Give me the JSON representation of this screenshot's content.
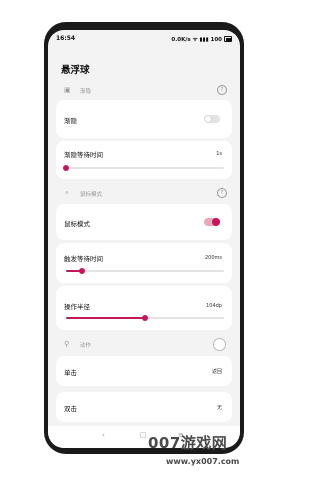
{
  "status": {
    "time": "16:54",
    "right": "0.0K/s ᯤ ▮▮▮ 100"
  },
  "app_title": "悬浮球",
  "sections": {
    "fade": {
      "icon": "▣",
      "label": "渐隐",
      "help": "?"
    },
    "mouse": {
      "icon": "⚬",
      "label": "鼠标模式",
      "help": "?"
    },
    "action": {
      "icon": "⚲",
      "label": "动作"
    }
  },
  "rows": {
    "fade_toggle": {
      "label": "渐隐",
      "state": "off"
    },
    "fade_wait": {
      "label": "渐隐等待时间",
      "value": "1s",
      "slider_fraction": 0.0
    },
    "mouse_toggle": {
      "label": "鼠标模式",
      "state": "on"
    },
    "trigger_wait": {
      "label": "触发等待时间",
      "value": "200ms",
      "slider_fraction": 0.1
    },
    "op_radius": {
      "label": "操作半径",
      "value": "104dp",
      "slider_fraction": 0.5
    },
    "single_tap": {
      "label": "单击",
      "value": "返回"
    },
    "double_tap": {
      "label": "双击",
      "value": "无"
    }
  },
  "nav": {
    "back": "‹",
    "home": "□",
    "recents": "≡"
  },
  "watermark": {
    "logo": "007游戏网",
    "url": "www.yx007.com"
  },
  "colors": {
    "accent": "#c2185b"
  }
}
